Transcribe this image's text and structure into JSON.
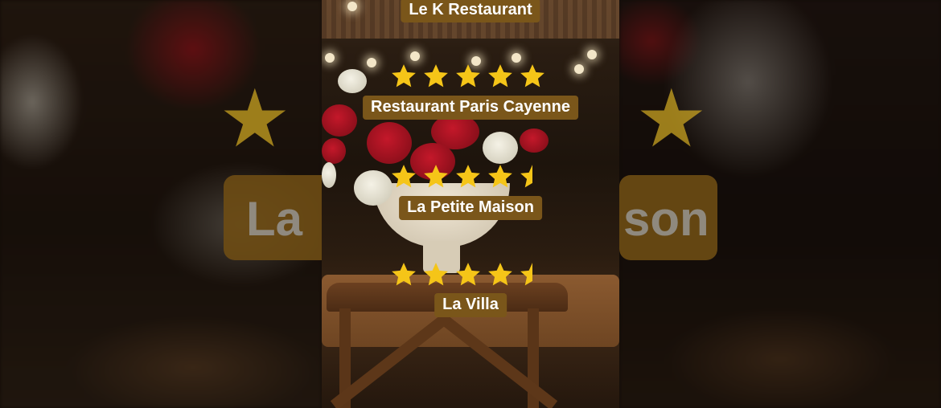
{
  "restaurants": [
    {
      "name": "Le K Restaurant",
      "rating": null
    },
    {
      "name": "Restaurant Paris Cayenne",
      "rating": 5
    },
    {
      "name": "La Petite Maison",
      "rating": 4.5
    },
    {
      "name": "La Villa",
      "rating": 4.5
    }
  ],
  "background_text": {
    "left": "La",
    "right": "son"
  },
  "colors": {
    "label_bg": "#7a561a",
    "star": "#f5c518",
    "text": "#ffffff"
  }
}
